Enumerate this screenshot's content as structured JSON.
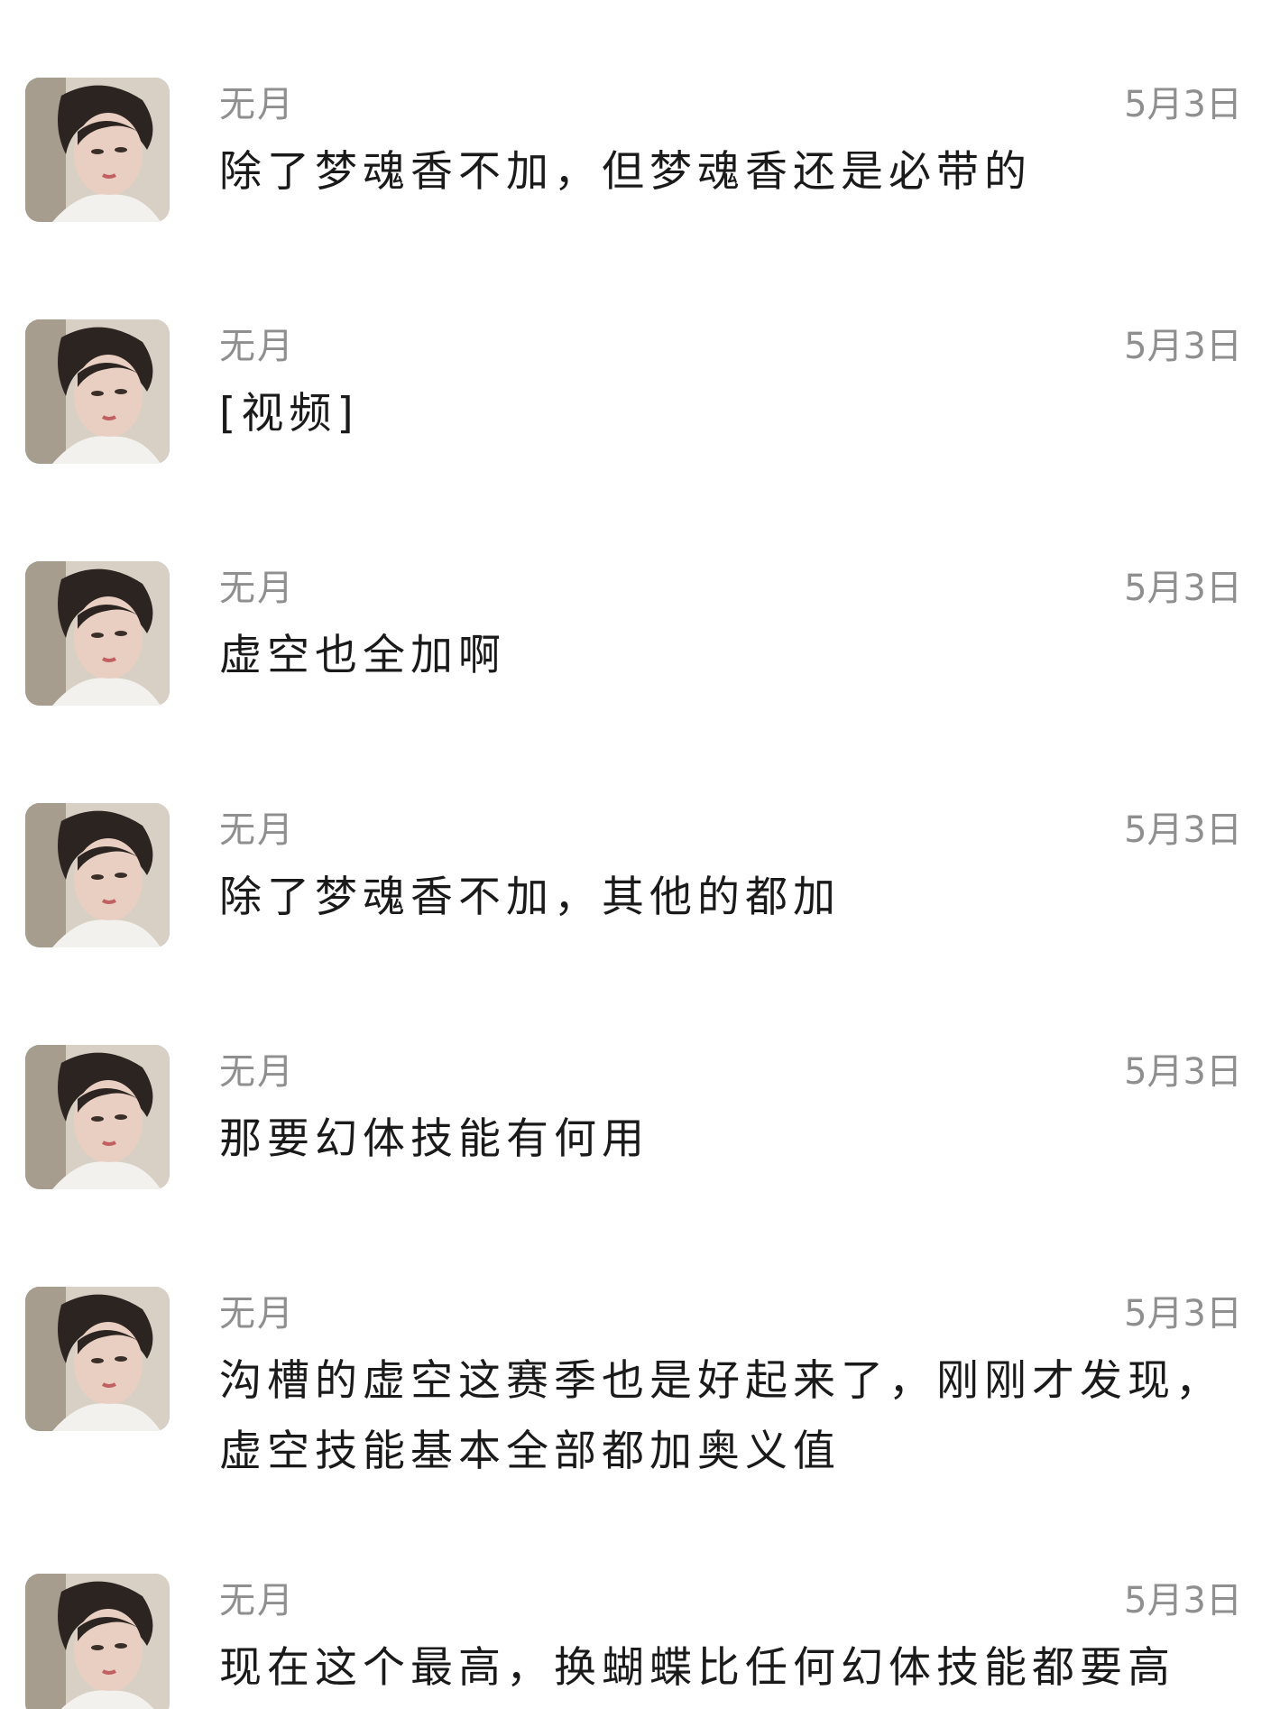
{
  "messages": [
    {
      "name": "无月",
      "time": "5月3日",
      "text": "除了梦魂香不加，但梦魂香还是必带的"
    },
    {
      "name": "无月",
      "time": "5月3日",
      "text": "[视频]"
    },
    {
      "name": "无月",
      "time": "5月3日",
      "text": "虚空也全加啊"
    },
    {
      "name": "无月",
      "time": "5月3日",
      "text": "除了梦魂香不加，其他的都加"
    },
    {
      "name": "无月",
      "time": "5月3日",
      "text": "那要幻体技能有何用"
    },
    {
      "name": "无月",
      "time": "5月3日",
      "text": "沟槽的虚空这赛季也是好起来了，刚刚才发现，虚空技能基本全部都加奥义值"
    },
    {
      "name": "无月",
      "time": "5月3日",
      "text": "现在这个最高，换蝴蝶比任何幻体技能都要高"
    }
  ]
}
